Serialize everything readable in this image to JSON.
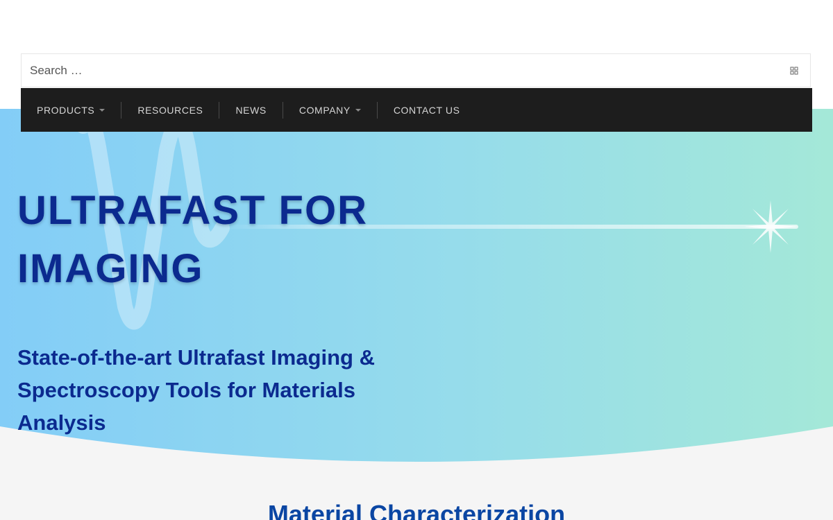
{
  "search": {
    "placeholder": "Search …",
    "icon": "search-icon"
  },
  "nav": {
    "items": [
      {
        "label": "PRODUCTS",
        "has_dropdown": true
      },
      {
        "label": "RESOURCES",
        "has_dropdown": false
      },
      {
        "label": "NEWS",
        "has_dropdown": false
      },
      {
        "label": "COMPANY",
        "has_dropdown": true
      },
      {
        "label": "CONTACT US",
        "has_dropdown": false
      }
    ]
  },
  "hero": {
    "title": "ULTRAFAST FOR IMAGING",
    "subtitle": "State-of-the-art Ultrafast Imaging & Spectroscopy Tools for Materials Analysis"
  },
  "section": {
    "heading": "Material Characterization"
  },
  "colors": {
    "nav_background": "#1d1d1d",
    "hero_gradient_start": "#83cdf7",
    "hero_gradient_end": "#a4e8d8",
    "heading_blue": "#0b2a8f",
    "section_heading_blue": "#0a46a3"
  }
}
